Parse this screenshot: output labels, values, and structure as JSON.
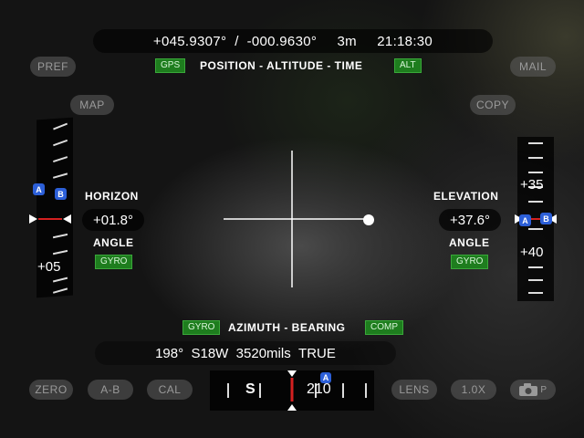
{
  "top": {
    "latitude": "+045.9307°",
    "separator": "/",
    "longitude": "-000.9630°",
    "altitude": "3m",
    "time": "21:18:30",
    "gps_tag": "GPS",
    "title": "POSITION - ALTITUDE - TIME",
    "alt_tag": "ALT"
  },
  "buttons": {
    "pref": "PREF",
    "mail": "MAIL",
    "map": "MAP",
    "copy": "COPY",
    "zero": "ZERO",
    "ab": "A-B",
    "cal": "CAL",
    "lens": "LENS",
    "zoom": "1.0X",
    "photo_mode": "P"
  },
  "horizon": {
    "title": "HORIZON",
    "value": "+01.8°",
    "subtitle": "ANGLE",
    "tag": "GYRO",
    "scale_label": "+05",
    "marker_a": "A",
    "marker_b": "B"
  },
  "elevation": {
    "title": "ELEVATION",
    "value": "+37.6°",
    "subtitle": "ANGLE",
    "tag": "GYRO",
    "scale_labels": [
      "+35",
      "+40"
    ],
    "marker_a": "A",
    "marker_b": "B"
  },
  "azimuth": {
    "gyro_tag": "GYRO",
    "title": "AZIMUTH - BEARING",
    "comp_tag": "COMP",
    "degrees": "198°",
    "cardinal": "S18W",
    "mils": "3520mils",
    "reference": "TRUE"
  },
  "compass": {
    "heading_label": "S",
    "number_label": "210",
    "marker_a": "A"
  },
  "colors": {
    "tag_green": "#1e7d1e",
    "marker_blue": "#2c5fd8",
    "heading_red": "#d42020"
  }
}
